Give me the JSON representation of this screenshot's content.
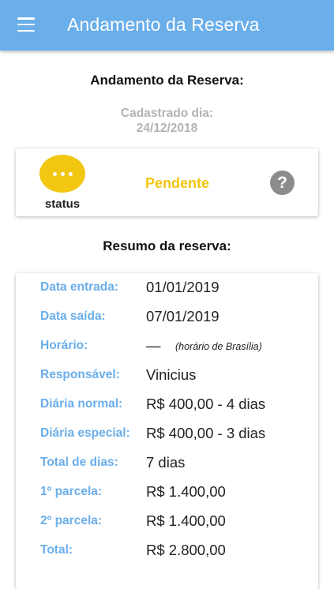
{
  "appbar": {
    "title": "Andamento da Reserva",
    "menu_icon": "menu-icon"
  },
  "page": {
    "heading": "Andamento da Reserva:",
    "created_label": "Cadastrado dia:",
    "created_date": "24/12/2018"
  },
  "status": {
    "icon": "more-horizontal-icon",
    "label": "status",
    "value": "Pendente",
    "help_icon": "?",
    "color": "#f2c611"
  },
  "summary": {
    "heading": "Resumo da reserva:",
    "rows": [
      {
        "label": "Data entrada:",
        "value": "01/01/2019",
        "note": ""
      },
      {
        "label": "Data saída:",
        "value": "07/01/2019",
        "note": ""
      },
      {
        "label": "Horário:",
        "value": "—",
        "note": "(horário de Brasília)"
      },
      {
        "label": "Responsável:",
        "value": "Vinicius",
        "note": ""
      },
      {
        "label": "Diária normal:",
        "value": "R$ 400,00 - 4 dias",
        "note": ""
      },
      {
        "label": "Diária especial:",
        "value": "R$ 400,00 - 3 dias",
        "note": ""
      },
      {
        "label": "Total de dias:",
        "value": "7 dias",
        "note": ""
      },
      {
        "label": "1º parcela:",
        "value": "R$ 1.400,00",
        "note": ""
      },
      {
        "label": "2º parcela:",
        "value": "R$ 1.400,00",
        "note": ""
      },
      {
        "label": "Total:",
        "value": "R$ 2.800,00",
        "note": ""
      }
    ]
  },
  "colors": {
    "primary": "#6aaeea",
    "accent": "#f2c611",
    "muted": "#b3b3b3"
  }
}
